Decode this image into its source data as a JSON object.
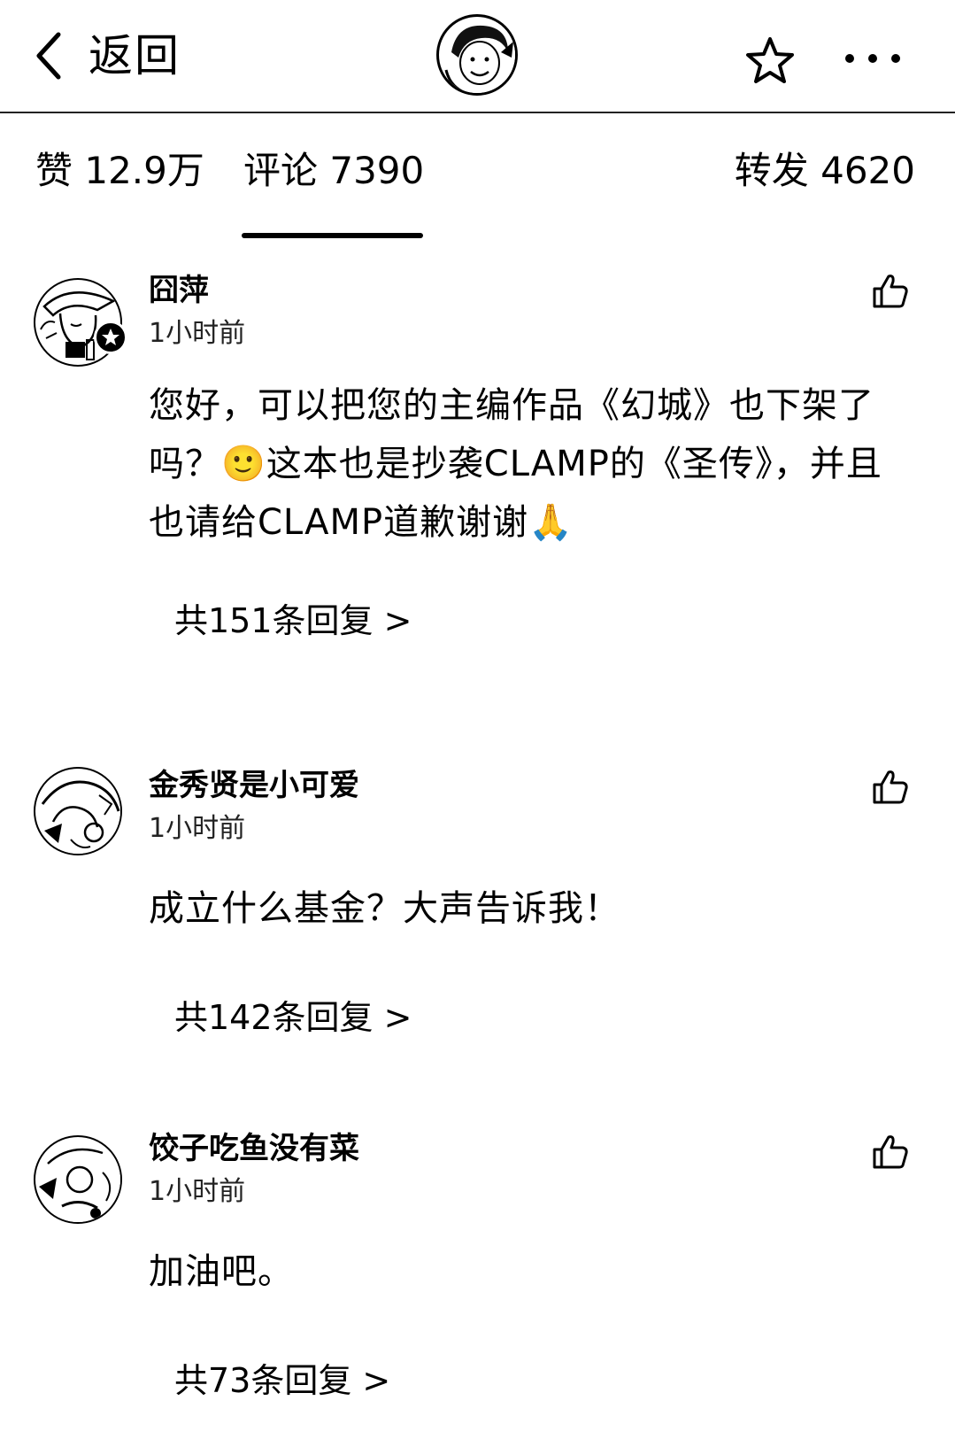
{
  "header": {
    "back_label": "返回",
    "icons": {
      "back": "chevron-left-icon",
      "favorite": "star-outline-icon",
      "more": "more-horizontal-icon"
    }
  },
  "tabs": {
    "likes": "赞 12.9万",
    "comments": "评论 7390",
    "reposts": "转发 4620",
    "active": "comments"
  },
  "comments": [
    {
      "user": "囧萍",
      "time": "1小时前",
      "text": "您好，可以把您的主编作品《幻城》也下架了吗？🙂这本也是抄袭CLAMP的《圣传》，并且也请给CLAMP道歉谢谢🙏",
      "replies": "共151条回复 >",
      "verified_badge": true
    },
    {
      "user": "金秀贤是小可爱",
      "time": "1小时前",
      "text": "成立什么基金？大声告诉我！",
      "replies": "共142条回复 >",
      "verified_badge": false
    },
    {
      "user": "饺子吃鱼没有菜",
      "time": "1小时前",
      "text": "加油吧。",
      "replies": "共73条回复 >",
      "verified_badge": false
    }
  ]
}
